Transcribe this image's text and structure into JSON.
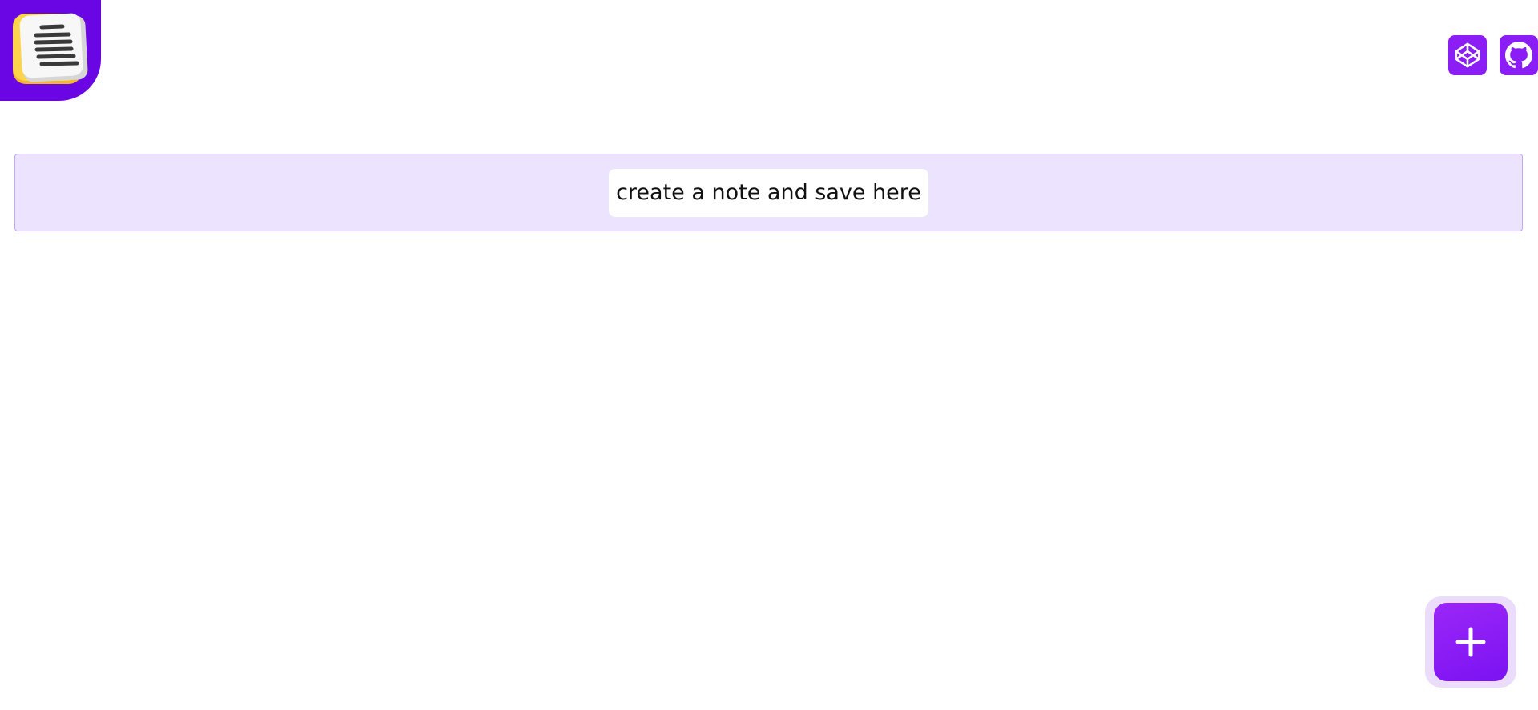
{
  "app": {
    "logo_icon": "notepad-icon",
    "accent_color": "#8a1ef5",
    "logo_bg_color": "#6a06e4"
  },
  "header": {
    "links": [
      {
        "icon": "codepen-icon"
      },
      {
        "icon": "github-icon"
      }
    ]
  },
  "main": {
    "empty_message": "create a note and save here"
  },
  "fab": {
    "icon": "plus-icon"
  }
}
